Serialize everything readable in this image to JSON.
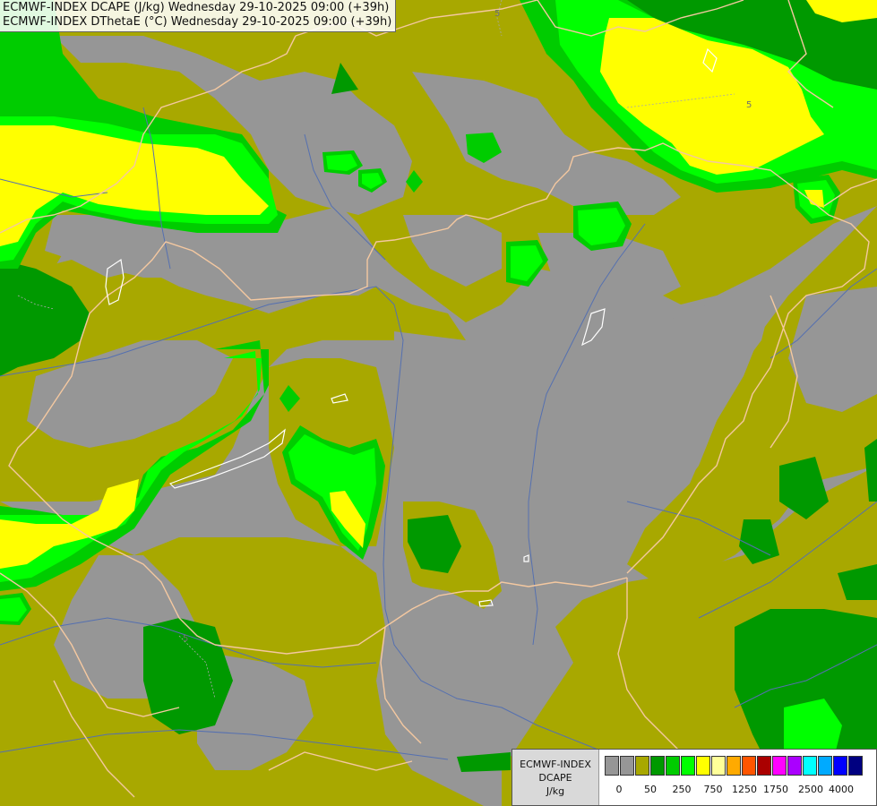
{
  "header": {
    "line1": "ECMWF-INDEX DCAPE (J/kg) Wednesday 29-10-2025 09:00 (+39h)",
    "line2": "ECMWF-INDEX DThetaE (°C) Wednesday 29-10-2025 09:00 (+39h)"
  },
  "legend": {
    "model": "ECMWF-INDEX",
    "field": "DCAPE",
    "unit": "J/kg",
    "colors": [
      "#969696",
      "#969696",
      "#a8a800",
      "#009900",
      "#00cc00",
      "#00ff00",
      "#ffff00",
      "#ffff99",
      "#ffaa00",
      "#ff5500",
      "#aa0000",
      "#ff00ff",
      "#aa00ff",
      "#00ffff",
      "#00aaff",
      "#0000ff",
      "#000080"
    ],
    "tick_labels": [
      "0",
      "50",
      "250",
      "750",
      "1250",
      "1750",
      "2500",
      "4000"
    ]
  },
  "map": {
    "colors": {
      "background": "#969696",
      "olive": "#a8a800",
      "dark_green": "#009900",
      "green": "#00cc00",
      "bright_green": "#00ff00",
      "yellow": "#ffff00",
      "border_line": "#f4c8a0",
      "river_line": "#5570b0",
      "lake_line": "#ffffff"
    },
    "contour_labels": [
      "5",
      "5",
      "5"
    ]
  }
}
